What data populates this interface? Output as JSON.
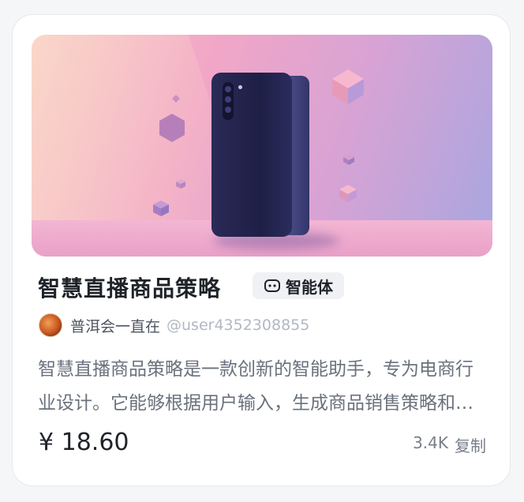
{
  "card": {
    "title": "智慧直播商品策略",
    "badge": {
      "icon": "robot-icon",
      "label": "智能体"
    },
    "author": {
      "name": "普洱会一直在",
      "handle": "@user4352308855"
    },
    "description": "智慧直播商品策略是一款创新的智能助手，专为电商行业设计。它能够根据用户输入，生成商品销售策略和直播话术。",
    "price": "¥ 18.60",
    "count": "3.4K",
    "action": "复制"
  },
  "colors": {
    "title": "#1f2329",
    "badge_bg": "#f0f1f4",
    "muted": "#6a717d",
    "handle": "#b2b7c2"
  }
}
